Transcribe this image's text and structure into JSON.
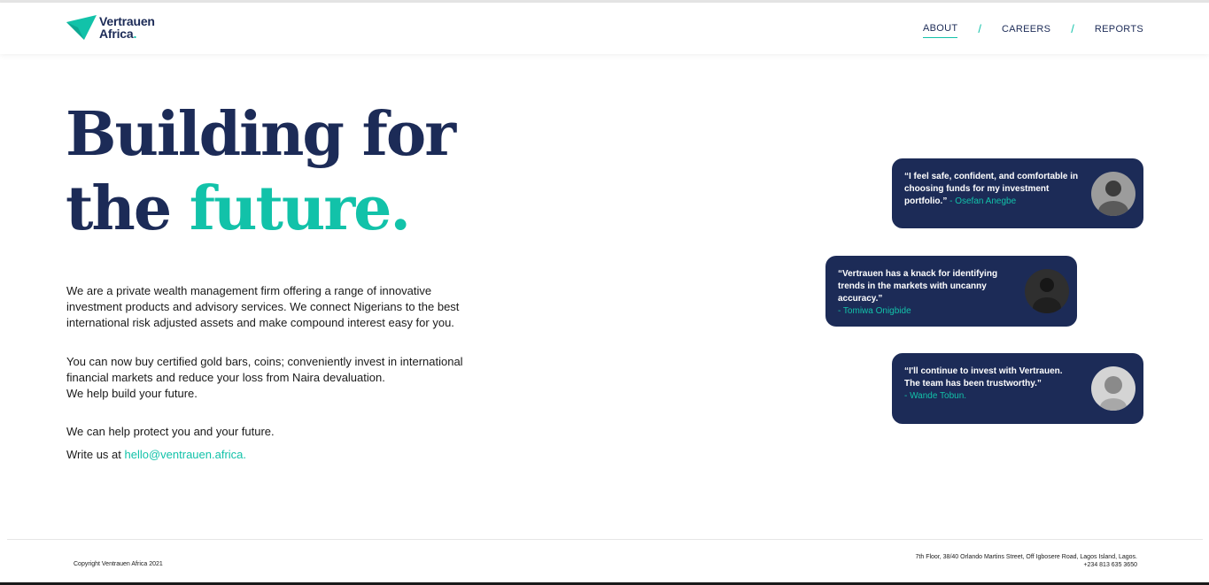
{
  "brand": {
    "name_line1": "Vertrauen",
    "name_line2": "Africa",
    "name_dot": ".",
    "logo_icon": "triangle-logo-icon",
    "primary_color": "#1c2b57",
    "accent_color": "#12c2a9"
  },
  "nav": {
    "items": [
      {
        "label": "ABOUT",
        "active": true
      },
      {
        "label": "CAREERS",
        "active": false
      },
      {
        "label": "REPORTS",
        "active": false
      }
    ],
    "separator": "/"
  },
  "hero": {
    "line1": "Building for",
    "line2_plain": "the ",
    "line2_accent": "future."
  },
  "body": {
    "paragraph1": "We are a private wealth management firm offering a range of innovative investment products and advisory services. We connect Nigerians to the best international risk adjusted assets and make compound interest easy for you.",
    "paragraph2": "You can now buy certified gold bars, coins; conveniently invest in international financial markets and reduce your loss from Naira devaluation.",
    "paragraph2b": "We help build your future.",
    "paragraph3": "We can help protect you and your future.",
    "write_us_prefix": "Write us at ",
    "email": "hello@ventrauen.africa."
  },
  "testimonials": [
    {
      "quote": "“I feel safe, confident, and comfortable in choosing funds for my investment portfolio.”",
      "author": " - Osefan Anegbe"
    },
    {
      "quote": "“Vertrauen has a knack for identifying trends in the markets with uncanny accuracy.”",
      "author": "- Tomiwa Onigbide"
    },
    {
      "quote": "“I'll continue to invest with Vertrauen. The team has been trustworthy.”",
      "author": "- Wande Tobun."
    }
  ],
  "footer": {
    "copyright": "Copyright Ventrauen Africa 2021",
    "address": "7th Floor, 38/40 Orlando Martins Street, Off Igbosere Road, Lagos Island, Lagos.",
    "phone": "+234 813 635 3650"
  }
}
